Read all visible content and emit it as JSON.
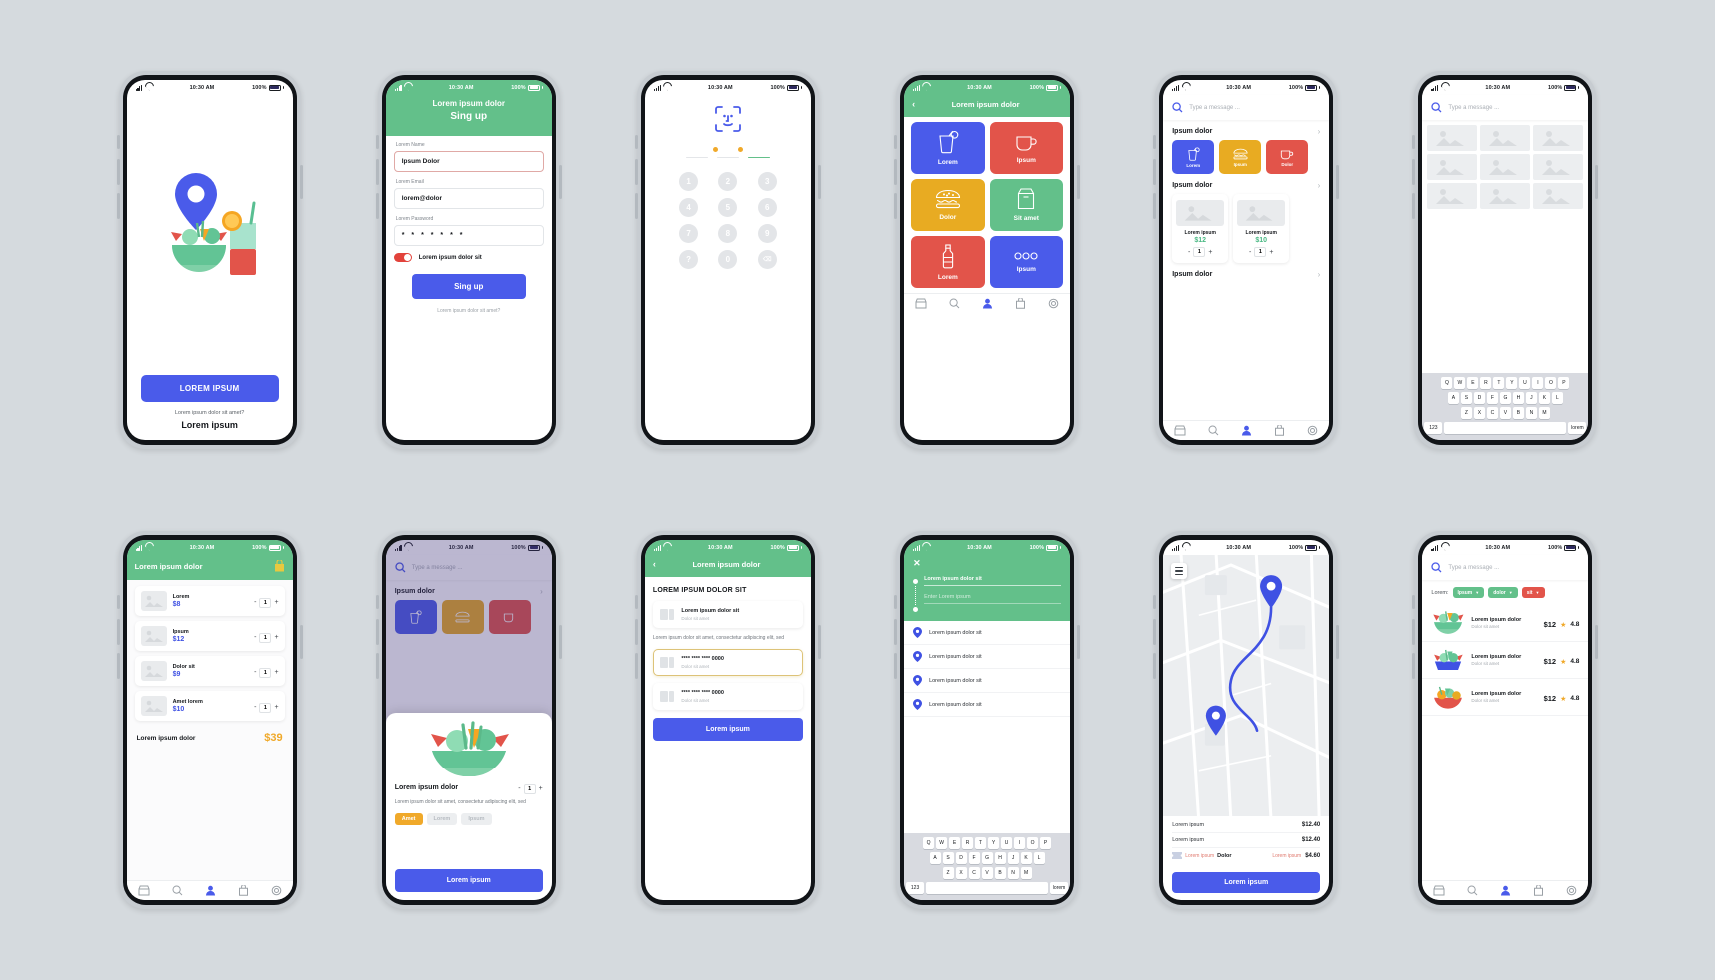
{
  "status_bar": {
    "time": "10:30 AM",
    "battery": "100%"
  },
  "colors": {
    "green": "#63c08a",
    "blue": "#4a5bea",
    "indigo": "#3f51e3",
    "red": "#e2544a",
    "yellow": "#e8ab22",
    "amber": "#f0a92a",
    "mint": "#49b883",
    "page_bg": "#d5dade"
  },
  "screens": {
    "onboarding": {
      "cta": "LOREM IPSUM",
      "sub": "Lorem ipsum dolor sit amet?",
      "sub2": "Lorem ipsum"
    },
    "signup": {
      "header_line1": "Lorem ipsum dolor",
      "header_line2": "Sing up",
      "name_label": "Lorem Name",
      "name_value": "Ipsum Dolor",
      "email_label": "Lorem Email",
      "email_value": "lorem@dolor",
      "password_label": "Lorem Password",
      "password_value": "* * * * * * *",
      "toggle_label": "Lorem ipsum dolor sit",
      "submit": "Sing up",
      "footer": "Lorem ipsum dolor sit amet?"
    },
    "passcode": {
      "keys": [
        "1",
        "2",
        "3",
        "4",
        "5",
        "6",
        "7",
        "8",
        "9",
        "?",
        "0",
        "⌫"
      ]
    },
    "categories": {
      "title": "Lorem ipsum dolor",
      "tiles": [
        {
          "label": "Lorem",
          "color": "#4a5bea",
          "icon": "drink-icon"
        },
        {
          "label": "Ipsum",
          "color": "#e2544a",
          "icon": "coffee-icon"
        },
        {
          "label": "Dolor",
          "color": "#e8ab22",
          "icon": "burger-icon"
        },
        {
          "label": "Sit amet",
          "color": "#63c08a",
          "icon": "bag-icon"
        },
        {
          "label": "Lorem",
          "color": "#e2544a",
          "icon": "bottle-icon"
        },
        {
          "label": "Ipsum",
          "color": "#4a5bea",
          "icon": "more-icon"
        }
      ]
    },
    "home_search": {
      "placeholder": "Type a message ...",
      "section1": "Ipsum dolor",
      "section2": "Ipsum dolor",
      "section3": "Ipsum dolor",
      "mini_cats": [
        {
          "label": "Lorem",
          "color": "#4a5bea",
          "icon": "drink-icon"
        },
        {
          "label": "Ipsum",
          "color": "#e8ab22",
          "icon": "burger-icon"
        },
        {
          "label": "Dolor",
          "color": "#e2544a",
          "icon": "coffee-icon"
        }
      ],
      "products": [
        {
          "name": "Lorem ipsum",
          "price": "$12",
          "qty": "1"
        },
        {
          "name": "Lorem ipsum",
          "price": "$10",
          "qty": "1"
        }
      ]
    },
    "gallery_keyboard": {
      "placeholder": "Type a message ...",
      "kb_row1": [
        "Q",
        "W",
        "E",
        "R",
        "T",
        "Y",
        "U",
        "I",
        "O",
        "P"
      ],
      "kb_row2": [
        "A",
        "S",
        "D",
        "F",
        "G",
        "H",
        "J",
        "K",
        "L"
      ],
      "kb_row3": [
        "Z",
        "X",
        "C",
        "V",
        "B",
        "N",
        "M"
      ],
      "kb_num": "123",
      "kb_space": "lorem"
    },
    "cart": {
      "title": "Lorem ipsum dolor",
      "items": [
        {
          "name": "Lorem",
          "price": "$8",
          "qty": "1"
        },
        {
          "name": "Ipsum",
          "price": "$12",
          "qty": "1"
        },
        {
          "name": "Dolor sit",
          "price": "$9",
          "qty": "1"
        },
        {
          "name": "Amet lorem",
          "price": "$10",
          "qty": "1"
        }
      ],
      "total_label": "Lorem ipsum dolor",
      "total_value": "$39"
    },
    "product_sheet": {
      "placeholder": "Type a message ...",
      "section": "Ipsum dolor",
      "name": "Lorem ipsum dolor",
      "qty": "1",
      "desc": "Lorem ipsum dolor sit amet, consectetur adipiscing elit, sed",
      "chips": [
        "Amet",
        "Lorem",
        "Ipsum"
      ],
      "cta": "Lorem ipsum"
    },
    "payment": {
      "title": "Lorem ipsum dolor",
      "heading": "LOREM IPSUM DOLOR SIT",
      "option1_t1": "Lorem ipsum dolor sit",
      "option1_t2": "Dolor sit amet",
      "note": "Lorem ipsum dolor sit amet, consectetur adipiscing elit, sed",
      "card1_t1": "**** **** **** 0000",
      "card1_t2": "Dolor sit amet",
      "card2_t1": "**** **** **** 0000",
      "card2_t2": "Dolor sit amet",
      "cta": "Lorem ipsum"
    },
    "address": {
      "from_value": "Lorem ipsum dolor sit",
      "to_placeholder": "Enter Lorem ipsum",
      "results": [
        "Lorem ipsum dolor sit",
        "Lorem ipsum dolor sit",
        "Lorem ipsum dolor sit",
        "Lorem ipsum dolor sit"
      ],
      "kb_row1": [
        "Q",
        "W",
        "E",
        "R",
        "T",
        "Y",
        "U",
        "I",
        "O",
        "P"
      ],
      "kb_row2": [
        "A",
        "S",
        "D",
        "F",
        "G",
        "H",
        "J",
        "K",
        "L"
      ],
      "kb_row3": [
        "Z",
        "X",
        "C",
        "V",
        "B",
        "N",
        "M"
      ],
      "kb_num": "123",
      "kb_space": "lorem"
    },
    "delivery_map": {
      "row1_label": "Lorem ipsum",
      "row1_value": "$12.40",
      "row2_label": "Lorem ipsum",
      "row2_value": "$12.40",
      "row3_tag": "Lorem ipsum",
      "row3_label": "Dolor",
      "row3_tag2": "Lorem ipsum",
      "row3_value": "$4.60",
      "cta": "Lorem ipsum"
    },
    "restaurants": {
      "placeholder": "Type a message ...",
      "filter_label": "Lorem:",
      "filters": [
        {
          "label": "Ipsum",
          "color": "#63c08a"
        },
        {
          "label": "dolor",
          "color": "#63c08a"
        },
        {
          "label": "sit",
          "color": "#e2544a"
        }
      ],
      "items": [
        {
          "name": "Lorem ipsum dolor",
          "desc": "Dolor sit amet",
          "price": "$12",
          "rating": "4.8",
          "art": "salad-green"
        },
        {
          "name": "Lorem ipsum dolor",
          "desc": "Dolor sit amet",
          "price": "$12",
          "rating": "4.8",
          "art": "salad-blue"
        },
        {
          "name": "Lorem ipsum dolor",
          "desc": "Dolor sit amet",
          "price": "$12",
          "rating": "4.8",
          "art": "salad-red"
        }
      ]
    }
  }
}
